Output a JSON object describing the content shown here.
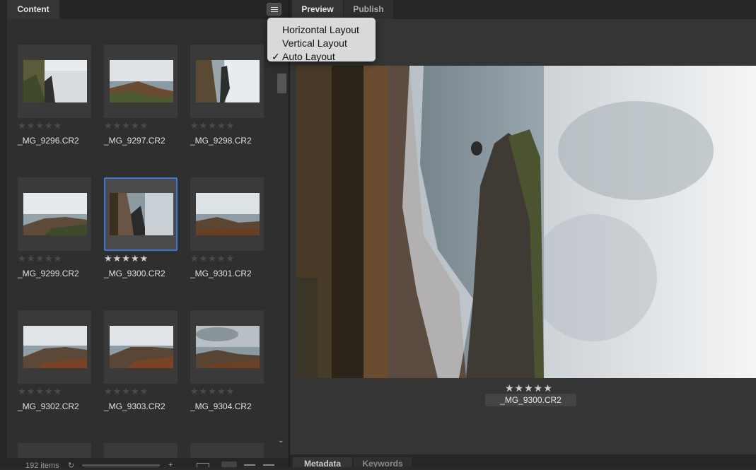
{
  "content_panel": {
    "tab_label": "Content",
    "items_count": "192 items"
  },
  "layout_menu": {
    "items": [
      "Horizontal Layout",
      "Vertical Layout",
      "Auto Layout"
    ],
    "checked": "Auto Layout",
    "check_glyph": "✓"
  },
  "thumbnails": [
    {
      "filename": "_MG_9296.CR2",
      "rating": 0,
      "stars": "★★★★★"
    },
    {
      "filename": "_MG_9297.CR2",
      "rating": 0,
      "stars": "★★★★★"
    },
    {
      "filename": "_MG_9298.CR2",
      "rating": 0,
      "stars": "★★★★★"
    },
    {
      "filename": "_MG_9299.CR2",
      "rating": 0,
      "stars": "★★★★★"
    },
    {
      "filename": "_MG_9300.CR2",
      "rating": 5,
      "stars": "★★★★★",
      "selected": true
    },
    {
      "filename": "_MG_9301.CR2",
      "rating": 0,
      "stars": "★★★★★"
    },
    {
      "filename": "_MG_9302.CR2",
      "rating": 0,
      "stars": "★★★★★"
    },
    {
      "filename": "_MG_9303.CR2",
      "rating": 0,
      "stars": "★★★★★"
    },
    {
      "filename": "_MG_9304.CR2",
      "rating": 0,
      "stars": "★★★★★"
    }
  ],
  "preview_panel": {
    "tabs": [
      "Preview",
      "Publish"
    ],
    "active_tab": "Preview",
    "filename": "_MG_9300.CR2",
    "stars": "★★★★★",
    "rating": 5
  },
  "bottom_tabs": [
    "Metadata",
    "Keywords"
  ],
  "colors": {
    "selection_border": "#3b78d8",
    "panel_bg": "#2f2f2f",
    "menu_bg": "#d9d9d9"
  }
}
